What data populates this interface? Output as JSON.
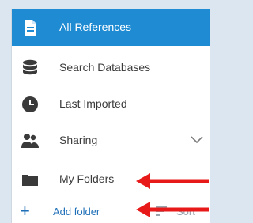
{
  "nav": {
    "items": [
      {
        "label": "All References",
        "icon": "document-icon"
      },
      {
        "label": "Search Databases",
        "icon": "database-icon"
      },
      {
        "label": "Last Imported",
        "icon": "clock-icon"
      },
      {
        "label": "Sharing",
        "icon": "people-icon"
      },
      {
        "label": "My Folders",
        "icon": "folder-icon"
      }
    ],
    "add_folder_label": "Add folder",
    "sort_label": "Sort",
    "add_icon_glyph": "+"
  },
  "colors": {
    "active": "#1f8bd3",
    "link": "#1f6fb8",
    "annotation_arrow": "#e81919"
  }
}
